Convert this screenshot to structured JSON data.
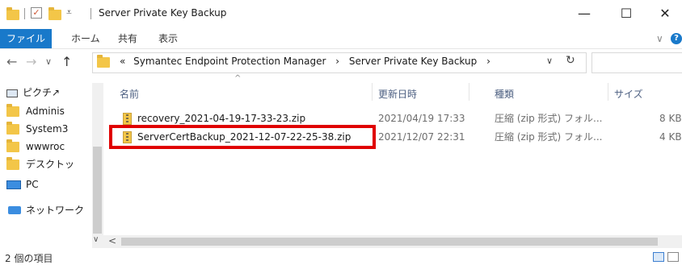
{
  "window": {
    "title": "Server Private Key Backup",
    "minimize": "—",
    "maximize": "☐",
    "close": "✕"
  },
  "ribbon": {
    "tabs": [
      "ファイル",
      "ホーム",
      "共有",
      "表示"
    ],
    "chevron": "∨"
  },
  "address": {
    "prefix": "«",
    "crumbs": [
      "Symantec Endpoint Protection Manager",
      "Server Private Key Backup"
    ],
    "sep": "›",
    "dropdown": "∨",
    "refresh": "↻"
  },
  "nav": {
    "back": "←",
    "forward": "→",
    "recent": "∨",
    "up": "↑",
    "items": [
      "ピクチ↗",
      "Adminis",
      "System3",
      "wwwroc",
      "デスクトッ",
      "PC",
      "ネットワーク"
    ]
  },
  "columns": [
    "名前",
    "更新日時",
    "種類",
    "サイズ"
  ],
  "files": [
    {
      "name": "recovery_2021-04-19-17-33-23.zip",
      "date": "2021/04/19 17:33",
      "type": "圧縮 (zip 形式) フォル...",
      "size": "8 KB"
    },
    {
      "name": "ServerCertBackup_2021-12-07-22-25-38.zip",
      "date": "2021/12/07 22:31",
      "type": "圧縮 (zip 形式) フォル...",
      "size": "4 KB"
    }
  ],
  "status": {
    "count": "2 個の項目"
  },
  "colors": {
    "file_tab": "#1979ca",
    "highlight": "#e00000",
    "folder": "#f3c648"
  }
}
